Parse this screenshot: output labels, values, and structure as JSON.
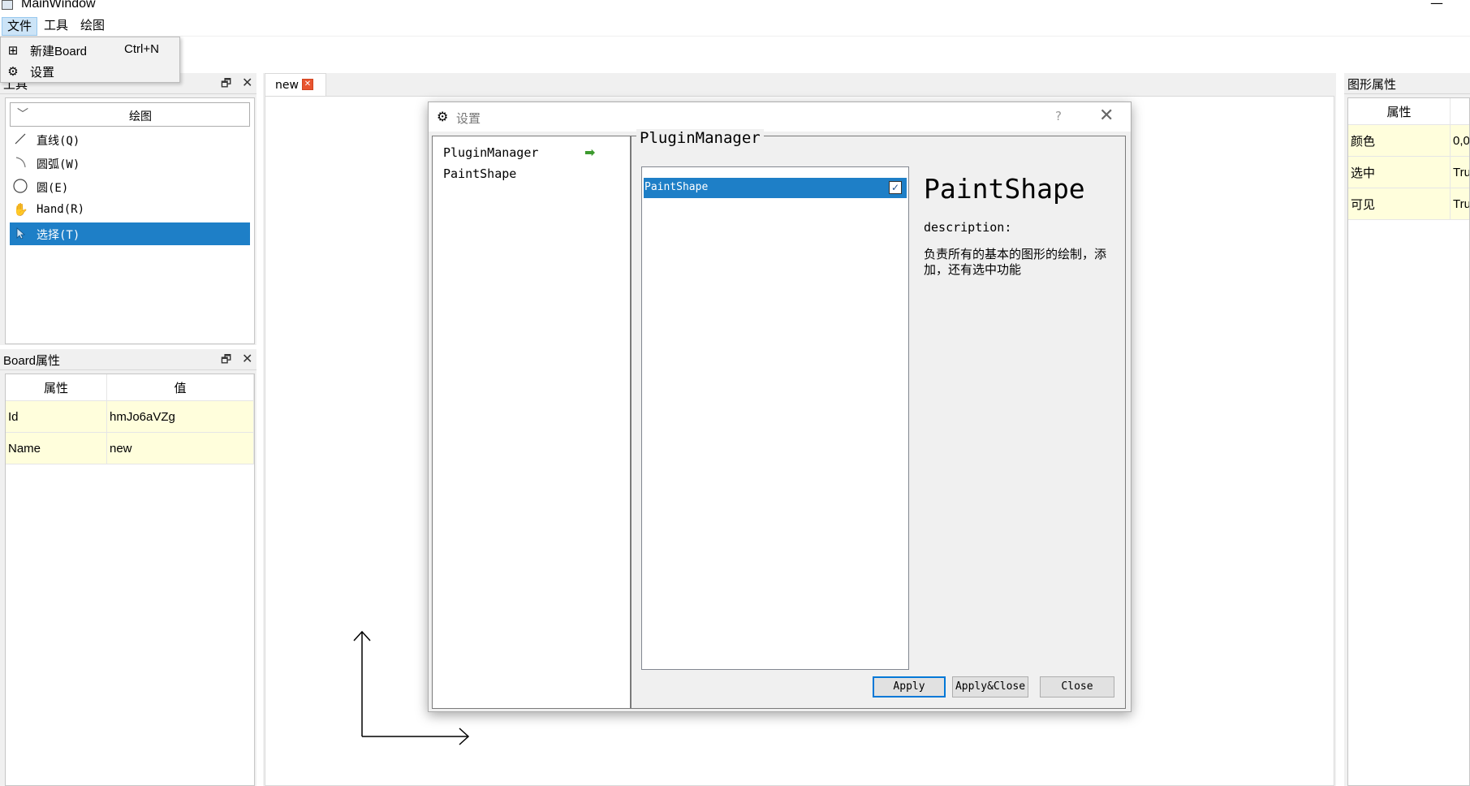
{
  "window": {
    "title": "MainWindow",
    "minimize_glyph": "—"
  },
  "menubar": {
    "items": [
      "文件",
      "工具",
      "绘图"
    ]
  },
  "file_menu": {
    "items": [
      {
        "icon": "new-board-icon",
        "label": "新建Board",
        "shortcut": "Ctrl+N"
      },
      {
        "icon": "gear-icon",
        "label": "设置",
        "shortcut": ""
      }
    ]
  },
  "tools_dock": {
    "title": "工具",
    "header": "绘图",
    "tools": [
      {
        "icon": "line-icon",
        "label": "直线(Q)"
      },
      {
        "icon": "arc-icon",
        "label": "圆弧(W)"
      },
      {
        "icon": "circle-icon",
        "label": "圆(E)"
      },
      {
        "icon": "hand-icon",
        "label": "Hand(R)"
      },
      {
        "icon": "pointer-icon",
        "label": "选择(T)",
        "selected": true
      }
    ]
  },
  "board_dock": {
    "title": "Board属性",
    "columns": [
      "属性",
      "值"
    ],
    "rows": [
      {
        "key": "Id",
        "value": "hmJo6aVZg"
      },
      {
        "key": "Name",
        "value": "new"
      }
    ]
  },
  "tabs": [
    {
      "label": "new"
    }
  ],
  "shape_dock": {
    "title": "图形属性",
    "columns": [
      "属性",
      ""
    ],
    "rows": [
      {
        "key": "颜色",
        "value": "0,0"
      },
      {
        "key": "选中",
        "value": "Tru"
      },
      {
        "key": "可见",
        "value": "Tru"
      }
    ]
  },
  "dialog": {
    "title": "设置",
    "help": "?",
    "plugin_list": [
      "PluginManager",
      "PaintShape"
    ],
    "group_title": "PluginManager",
    "plugins": [
      {
        "name": "PaintShape",
        "checked": true
      }
    ],
    "detail": {
      "name": "PaintShape",
      "desc_label": "description:",
      "desc": "负责所有的基本的图形的绘制，添加，还有选中功能"
    },
    "buttons": {
      "apply": "Apply",
      "apply_close": "Apply&Close",
      "close": "Close"
    }
  },
  "colors": {
    "selection": "#1e7fc7",
    "accent_close": "#e8542f",
    "arrow": "#3d9a2e",
    "table_row": "#fffedc"
  }
}
